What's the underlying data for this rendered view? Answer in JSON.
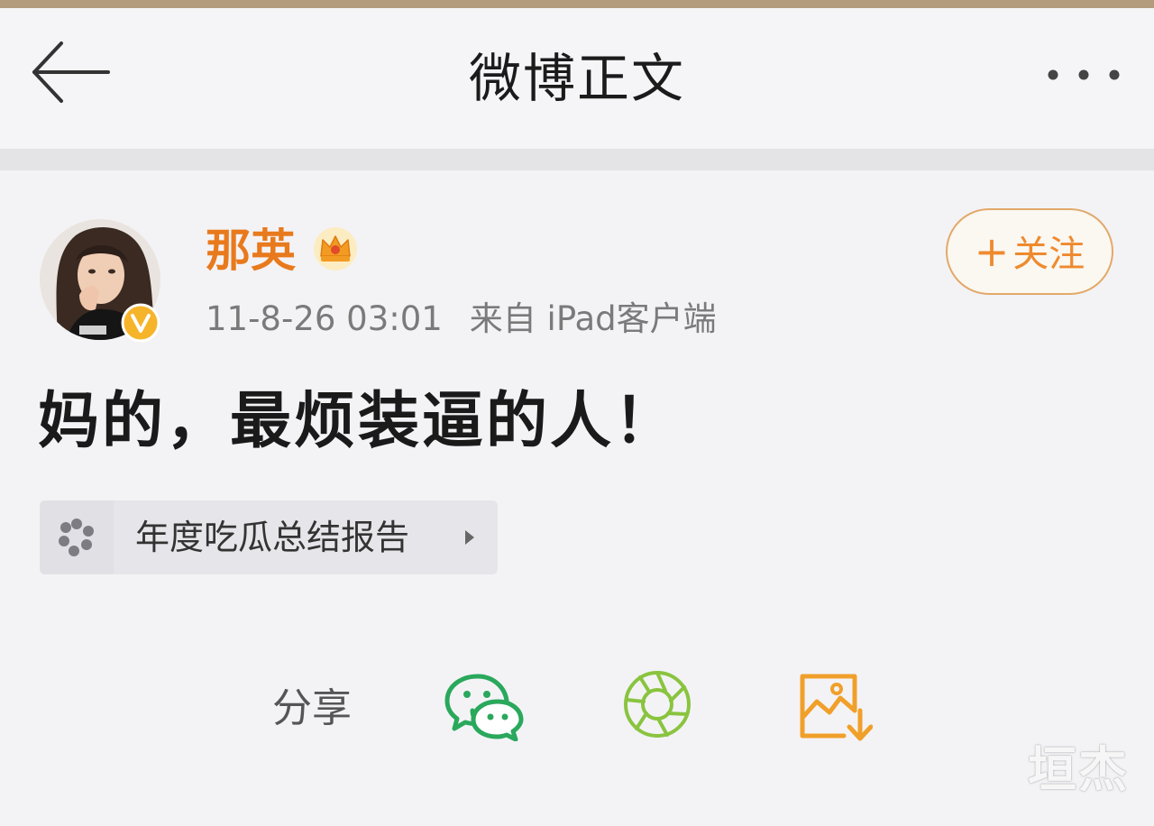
{
  "header": {
    "title": "微博正文",
    "back_icon": "back-arrow-icon",
    "more_icon": "more-dots-icon"
  },
  "post": {
    "author": {
      "name": "那英",
      "avatar_icon": "avatar",
      "verified_badge": "verified-v-icon",
      "member_badge": "crown-icon"
    },
    "timestamp": "11-8-26 03:01",
    "source": "来自 iPad客户端",
    "follow": {
      "plus": "+",
      "label": "关注"
    },
    "content": "妈的，最烦装逼的人！",
    "topic": {
      "label": "年度吃瓜总结报告",
      "icon": "flower-spinner-icon",
      "arrow_icon": "chevron-right-icon"
    }
  },
  "share": {
    "label": "分享",
    "targets": [
      "wechat-icon",
      "moments-icon",
      "save-image-icon"
    ]
  },
  "watermark": "垣杰",
  "colors": {
    "accent": "#e87a1d",
    "follow_border": "#e2a96a",
    "wechat_green": "#2aa85c",
    "moments_green": "#8ac43f",
    "save_orange": "#f0a02a"
  }
}
